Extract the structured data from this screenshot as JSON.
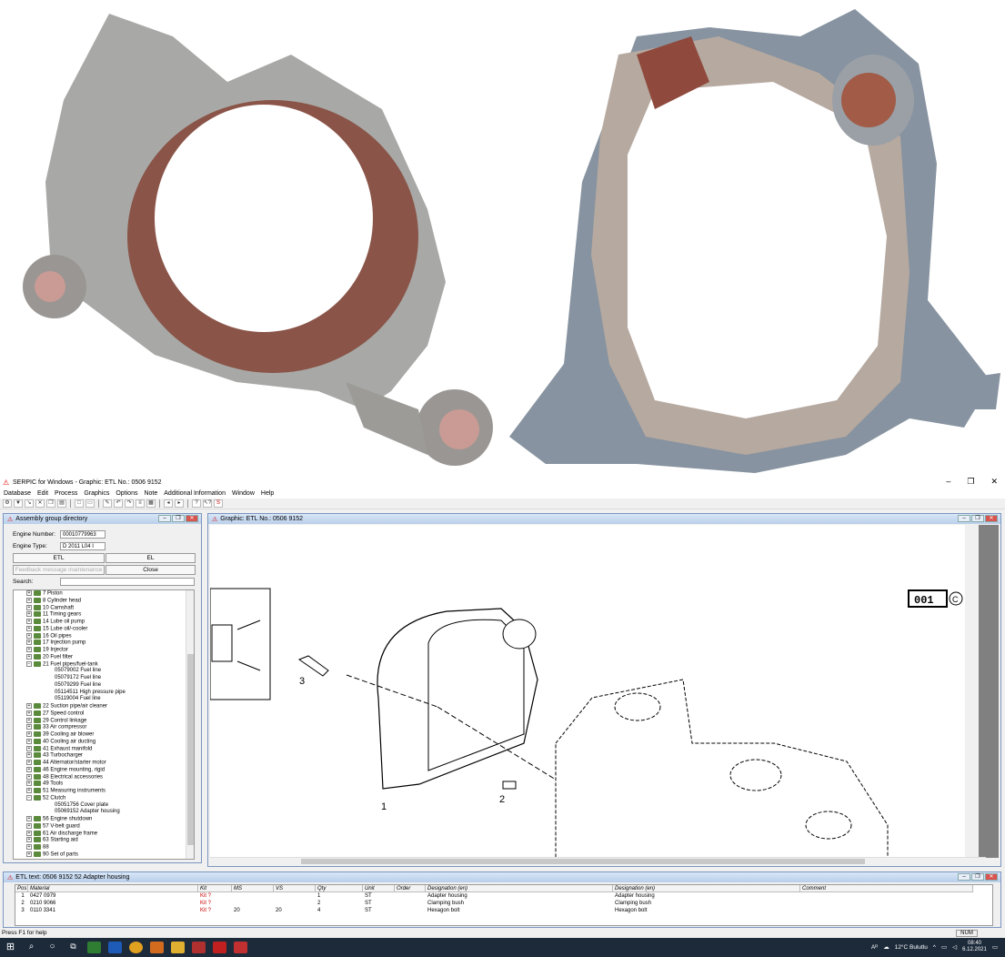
{
  "window": {
    "title": "SERPIC for Windows - Graphic: ETL No.: 0506 9152",
    "minimize": "–",
    "maximize": "❐",
    "close": "✕"
  },
  "menu": [
    "Database",
    "Edit",
    "Process",
    "Graphics",
    "Options",
    "Note",
    "Additional Information",
    "Window",
    "Help"
  ],
  "assembly": {
    "title": "Assembly group directory",
    "engine_number_label": "Engine Number:",
    "engine_number": "00010779963",
    "engine_type_label": "Engine Type:",
    "engine_type": "D 2011 L04 I",
    "etl_button": "ETL",
    "el_button": "EL",
    "feedback_button": "Feedback message maintenance",
    "close_button": "Close",
    "search_label": "Search:",
    "tree": [
      {
        "text": "7  Piston",
        "level": "top"
      },
      {
        "text": "8  Cylinder head",
        "level": "top"
      },
      {
        "text": "10  Camshaft",
        "level": "top"
      },
      {
        "text": "11  Timing gears",
        "level": "top"
      },
      {
        "text": "14  Lube oil pump",
        "level": "top"
      },
      {
        "text": "15  Lube oil/-cooler",
        "level": "top"
      },
      {
        "text": "16  Oil pipes",
        "level": "top"
      },
      {
        "text": "17  Injection pump",
        "level": "top"
      },
      {
        "text": "19  Injector",
        "level": "top"
      },
      {
        "text": "20  Fuel filter",
        "level": "top"
      },
      {
        "text": "21  Fuel pipes/fuel-tank",
        "level": "top"
      },
      {
        "text": "05079002  Fuel line",
        "level": "child"
      },
      {
        "text": "05079172  Fuel line",
        "level": "child"
      },
      {
        "text": "05079299  Fuel line",
        "level": "child"
      },
      {
        "text": "05114511  High pressure pipe",
        "level": "child"
      },
      {
        "text": "05119004  Fuel line",
        "level": "child"
      },
      {
        "text": "22  Suction pipe/air cleaner",
        "level": "top"
      },
      {
        "text": "27  Speed control",
        "level": "top"
      },
      {
        "text": "29  Control linkage",
        "level": "top"
      },
      {
        "text": "33  Air compressor",
        "level": "top"
      },
      {
        "text": "39  Cooling air blower",
        "level": "top"
      },
      {
        "text": "40  Cooling air ducting",
        "level": "top"
      },
      {
        "text": "41  Exhaust manifold",
        "level": "top"
      },
      {
        "text": "43  Turbocharger",
        "level": "top"
      },
      {
        "text": "44  Alternator/starter motor",
        "level": "top"
      },
      {
        "text": "46  Engine mounting, rigid",
        "level": "top"
      },
      {
        "text": "48  Electrical accessories",
        "level": "top"
      },
      {
        "text": "49  Tools",
        "level": "top"
      },
      {
        "text": "51  Measuring instruments",
        "level": "top"
      },
      {
        "text": "52  Clutch",
        "level": "top"
      },
      {
        "text": "05051756  Cover plate",
        "level": "child"
      },
      {
        "text": "05069152  Adapter housing",
        "level": "child"
      },
      {
        "text": "56  Engine shutdown",
        "level": "top"
      },
      {
        "text": "57  V-belt guard",
        "level": "top"
      },
      {
        "text": "61  Air discharge frame",
        "level": "top"
      },
      {
        "text": "63  Starting aid",
        "level": "top"
      },
      {
        "text": "88",
        "level": "top"
      },
      {
        "text": "90  Set of parts",
        "level": "top"
      }
    ]
  },
  "graphic": {
    "title": "Graphic: ETL No.: 0506 9152",
    "code_box": "001",
    "copyright": "C",
    "callouts": [
      "1",
      "2",
      "3"
    ]
  },
  "etl": {
    "title": "ETL text: 0506 9152   52   Adapter housing",
    "columns": [
      "Pos",
      "Material",
      "Kit",
      "MS",
      "VS",
      "Qty",
      "Unit",
      "Order",
      "Designation (en)",
      "Designation (en)",
      "Comment"
    ],
    "rows": [
      [
        "1",
        "0427 0979",
        "Kit ?",
        "",
        "",
        "1",
        "ST",
        "",
        "Adapter housing",
        "Adapter housing",
        ""
      ],
      [
        "2",
        "0210 9066",
        "Kit ?",
        "",
        "",
        "2",
        "ST",
        "",
        "Clamping bush",
        "Clamping bush",
        ""
      ],
      [
        "3",
        "0110 3341",
        "Kit ?",
        "20",
        "20",
        "4",
        "ST",
        "",
        "Hexagon bolt",
        "Hexagon bolt",
        ""
      ]
    ]
  },
  "status": {
    "help": "Press F1 for help",
    "num": "NUM"
  },
  "taskbar": {
    "weather": "12°C  Bulutlu",
    "time": "08:40",
    "date": "6.12.2021",
    "lang": "Aᴿ"
  }
}
